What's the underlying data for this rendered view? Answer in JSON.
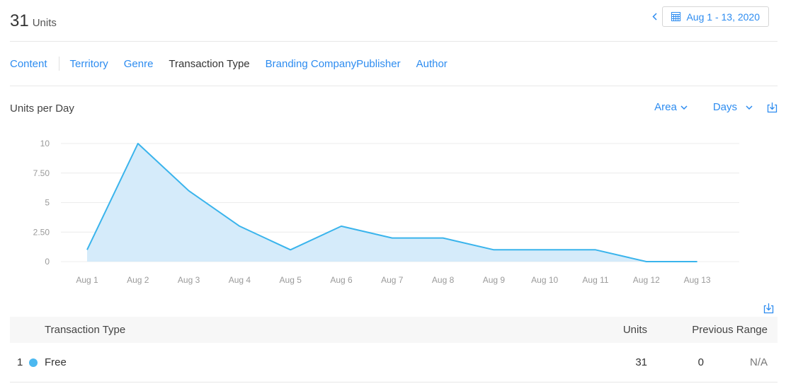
{
  "header": {
    "units_number": "31",
    "units_label": "Units",
    "date_range": "Aug 1 - 13, 2020"
  },
  "tabs": [
    {
      "label": "Content",
      "active": false
    },
    {
      "label": "Territory",
      "active": false
    },
    {
      "label": "Genre",
      "active": false
    },
    {
      "label": "Transaction Type",
      "active": true
    },
    {
      "label": "Branding CompanyPublisher",
      "active": false
    },
    {
      "label": "Author",
      "active": false
    }
  ],
  "chart_section": {
    "title": "Units per Day",
    "chart_type_label": "Area",
    "granularity_label": "Days"
  },
  "chart_data": {
    "type": "area",
    "title": "Units per Day",
    "categories": [
      "Aug 1",
      "Aug 2",
      "Aug 3",
      "Aug 4",
      "Aug 5",
      "Aug 6",
      "Aug 7",
      "Aug 8",
      "Aug 9",
      "Aug 10",
      "Aug 11",
      "Aug 12",
      "Aug 13"
    ],
    "series": [
      {
        "values": [
          1,
          10,
          6,
          3,
          1,
          3,
          2,
          2,
          1,
          1,
          1,
          0,
          0
        ]
      }
    ],
    "yticks": [
      "0",
      "2.50",
      "5",
      "7.50",
      "10"
    ],
    "ylim": [
      0,
      10
    ],
    "grid": true,
    "colors": {
      "line": "#3ab4ec",
      "fill": "#d5ebfa",
      "grid": "#ececec",
      "tick": "#9a9a9a"
    }
  },
  "table": {
    "columns": {
      "name": "Transaction Type",
      "units": "Units",
      "previous": "Previous Range"
    },
    "rows": [
      {
        "rank": "1",
        "name": "Free",
        "units": "31",
        "previous": "0",
        "change": "N/A",
        "color": "#4cb8f0"
      }
    ]
  },
  "icons": {
    "prev": "chevron-left-icon",
    "calendar": "calendar-icon",
    "dropdown": "chevron-down-icon",
    "download": "download-icon"
  },
  "accent_color": "#2d8cf0"
}
